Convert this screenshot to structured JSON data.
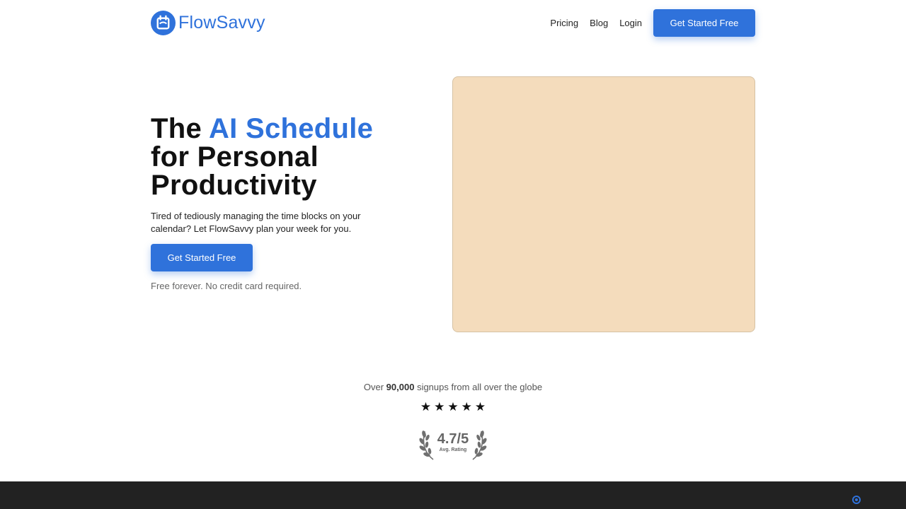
{
  "brand": {
    "name": "FlowSavvy",
    "icon": "calendar-refresh-icon",
    "color": "#2f72db"
  },
  "nav": {
    "links": [
      "Pricing",
      "Blog",
      "Login"
    ],
    "cta": "Get Started Free"
  },
  "hero": {
    "title_line1_pre": "The",
    "title_line1_accent": "AI Schedule",
    "title_line2": "for Personal",
    "title_line3": "Productivity",
    "subtitle": "Tired of tediously managing the time blocks on your calendar? Let FlowSavvy plan your week for you.",
    "cta": "Get Started Free",
    "note": "Free forever. No credit card required.",
    "media_color": "#f4dcbc"
  },
  "social_proof": {
    "signups_pre": "Over",
    "signups_count": "90,000",
    "signups_post": "signups from all over the globe",
    "stars": 5,
    "rating": "4.7/5",
    "rating_label": "Avg. Rating"
  },
  "footer": {
    "background": "#222222",
    "icon": "gear-icon"
  }
}
